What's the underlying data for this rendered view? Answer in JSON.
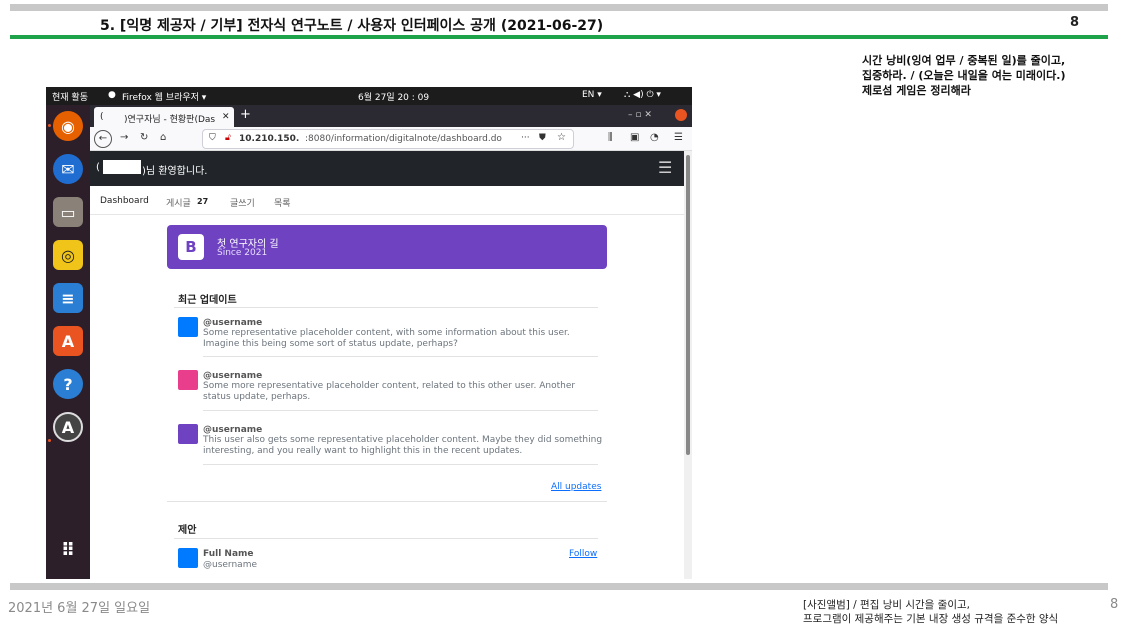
{
  "slide": {
    "title": "5. [익명 제공자 / 기부] 전자식 연구노트 / 사용자 인터페이스 공개 (2021-06-27)",
    "page_number_top": "8",
    "side_note": [
      "시간 낭비(잉여 업무 / 중복된 일)를 줄이고,",
      "집중하라. / (오늘은 내일을 여는 미래이다.)",
      "제로섬 게임은 정리해라"
    ],
    "footer_date": "2021년 6월 27일 일요일",
    "footer_note": [
      "[사진앨범] / 편집 낭비 시간을 줄이고,",
      "프로그램이 제공해주는 기본 내장 생성 규격을 준수한 양식"
    ],
    "page_number_bottom": "8",
    "colors": {
      "green_bar": "#1fa34a",
      "gray_bar": "#c8c8c8"
    }
  },
  "gnome": {
    "activities": "현재 활동",
    "app_menu": "Firefox 웹 브라우저 ▾",
    "clock": "6월 27일 20 : 09",
    "lang": "EN ▾",
    "tray": "⛬ ◀) ⏻ ▾"
  },
  "dock": {
    "items": [
      "firefox-icon",
      "thunderbird-icon",
      "files-icon",
      "rhythmbox-icon",
      "writer-icon",
      "software-icon",
      "help-icon",
      "updater-icon",
      "app-grid-icon"
    ]
  },
  "browser": {
    "tab_prefix": "(",
    "tab_title": ")연구자님 - 현황판(Das",
    "tab_close": "✕",
    "new_tab": "+",
    "url_host": "10.210.150.",
    "url_path": ":8080/information/digitalnote/dashboard.do",
    "url_more": "···",
    "win_controls": "–  ▫  ✕"
  },
  "page": {
    "welcome_suffix": ")님 환영합니다.",
    "welcome_prefix": "(",
    "nav": {
      "dashboard": "Dashboard",
      "posts": "게시글",
      "posts_count": "27",
      "write": "글쓰기",
      "list": "목록"
    },
    "banner": {
      "logo": "B",
      "title": "첫 연구자의 길",
      "subtitle": "Since 2021",
      "color": "#6f42c1"
    },
    "updates": {
      "title": "최근 업데이트",
      "items": [
        {
          "user": "@username",
          "color": "#007bff",
          "text": "Some representative placeholder content, with some information about this user. Imagine this being some sort of status update, perhaps?"
        },
        {
          "user": "@username",
          "color": "#e83e8c",
          "text": "Some more representative placeholder content, related to this other user. Another status update, perhaps."
        },
        {
          "user": "@username",
          "color": "#6f42c1",
          "text": "This user also gets some representative placeholder content. Maybe they did something interesting, and you really want to highlight this in the recent updates."
        }
      ],
      "all_link": "All updates"
    },
    "suggestions": {
      "title": "제안",
      "items": [
        {
          "name": "Full Name",
          "user": "@username",
          "follow": "Follow",
          "color": "#007bff"
        }
      ]
    }
  }
}
